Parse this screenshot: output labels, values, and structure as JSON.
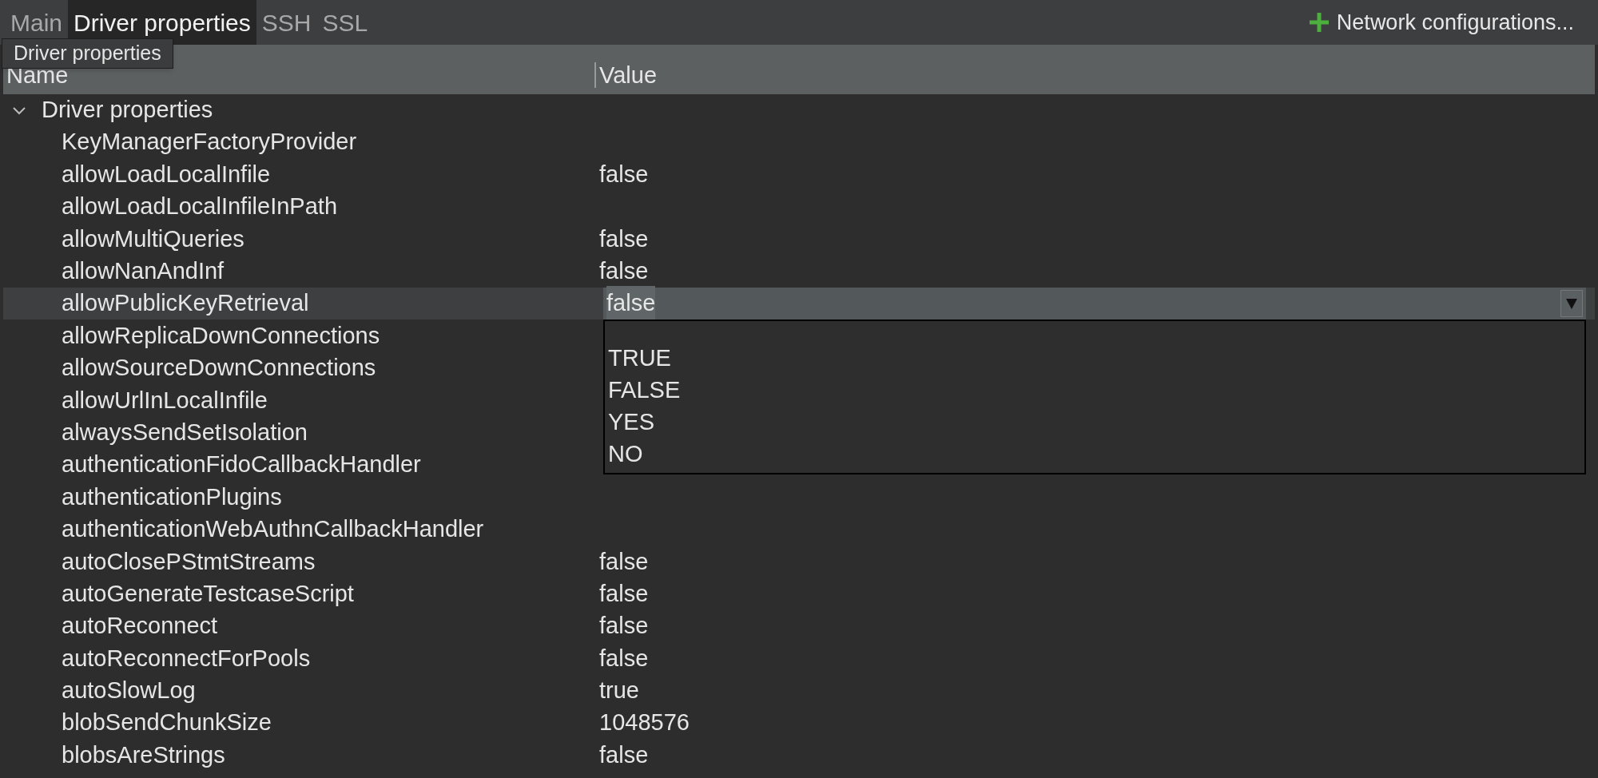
{
  "tabs": [
    {
      "label": "Main",
      "selected": false
    },
    {
      "label": "Driver properties",
      "selected": true
    },
    {
      "label": "SSH",
      "selected": false
    },
    {
      "label": "SSL",
      "selected": false
    }
  ],
  "tooltip": "Driver properties",
  "network_button": {
    "label": "Network configurations..."
  },
  "table": {
    "columns": [
      "Name",
      "Value"
    ],
    "group": {
      "label": "Driver properties",
      "expanded": true,
      "rows": [
        {
          "name": "KeyManagerFactoryProvider",
          "selected": false
        },
        {
          "name": "allowLoadLocalInfile",
          "value": "false",
          "selected": false
        },
        {
          "name": "allowLoadLocalInfileInPath",
          "selected": false
        },
        {
          "name": "allowMultiQueries",
          "value": "false",
          "selected": false
        },
        {
          "name": "allowNanAndInf",
          "value": "false",
          "selected": false
        },
        {
          "name": "allowPublicKeyRetrieval",
          "selected": true,
          "editor": {
            "value": "false",
            "options": [
              "TRUE",
              "FALSE",
              "YES",
              "NO"
            ]
          }
        },
        {
          "name": "allowReplicaDownConnections",
          "selected": false
        },
        {
          "name": "allowSourceDownConnections",
          "selected": false
        },
        {
          "name": "allowUrlInLocalInfile",
          "selected": false
        },
        {
          "name": "alwaysSendSetIsolation",
          "selected": false
        },
        {
          "name": "authenticationFidoCallbackHandler",
          "selected": false
        },
        {
          "name": "authenticationPlugins",
          "selected": false
        },
        {
          "name": "authenticationWebAuthnCallbackHandler",
          "selected": false
        },
        {
          "name": "autoClosePStmtStreams",
          "value": "false",
          "selected": false
        },
        {
          "name": "autoGenerateTestcaseScript",
          "value": "false",
          "selected": false
        },
        {
          "name": "autoReconnect",
          "value": "false",
          "selected": false
        },
        {
          "name": "autoReconnectForPools",
          "value": "false",
          "selected": false
        },
        {
          "name": "autoSlowLog",
          "value": "true",
          "selected": false
        },
        {
          "name": "blobSendChunkSize",
          "value": "1048576",
          "selected": false
        },
        {
          "name": "blobsAreStrings",
          "value": "false",
          "selected": false
        }
      ]
    }
  }
}
